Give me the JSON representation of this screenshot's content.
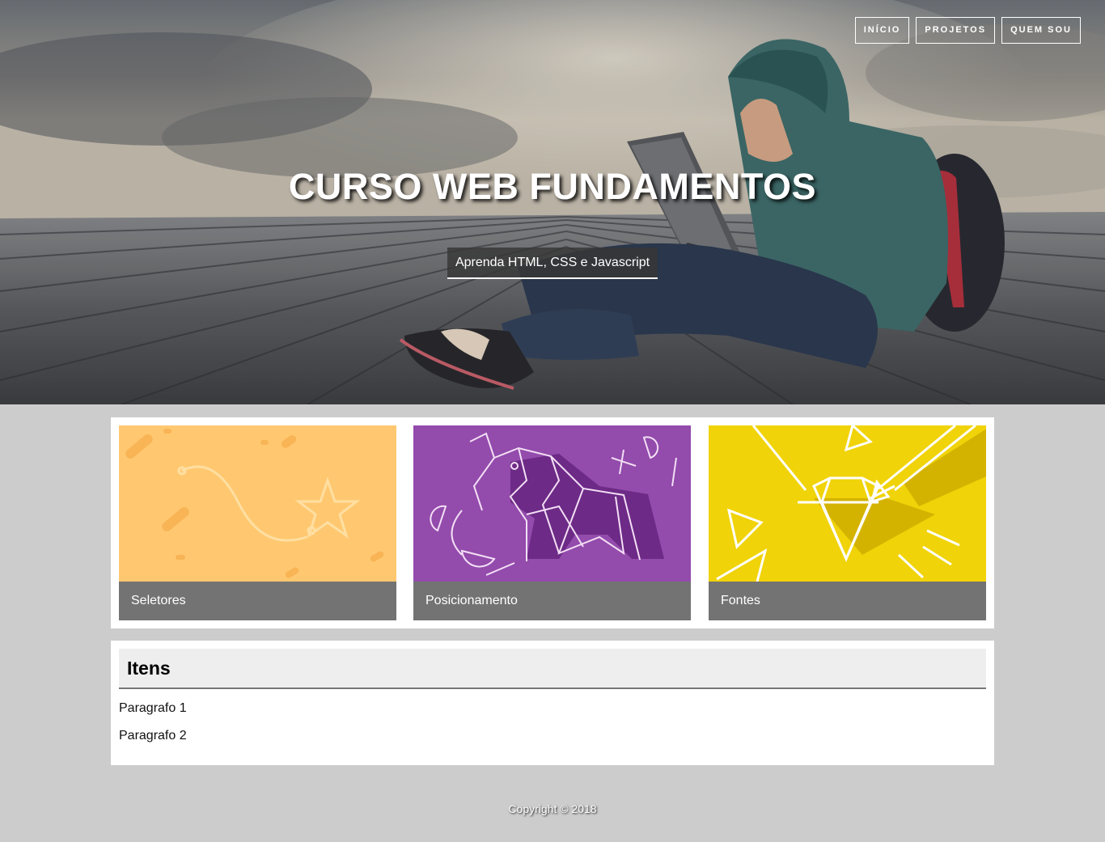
{
  "nav": {
    "items": [
      {
        "label": "INÍCIO"
      },
      {
        "label": "PROJETOS"
      },
      {
        "label": "QUEM SOU"
      }
    ]
  },
  "hero": {
    "title": "CURSO WEB FUNDAMENTOS",
    "subtitle": "Aprenda HTML, CSS e Javascript"
  },
  "cards": [
    {
      "label": "Seletores",
      "color": "#ffc870"
    },
    {
      "label": "Posicionamento",
      "color": "#934bac"
    },
    {
      "label": "Fontes",
      "color": "#f0d308"
    }
  ],
  "items_section": {
    "title": "Itens",
    "paragraphs": [
      "Paragrafo 1",
      "Paragrafo 2"
    ]
  },
  "footer": {
    "text": "Copyright © 2018"
  }
}
